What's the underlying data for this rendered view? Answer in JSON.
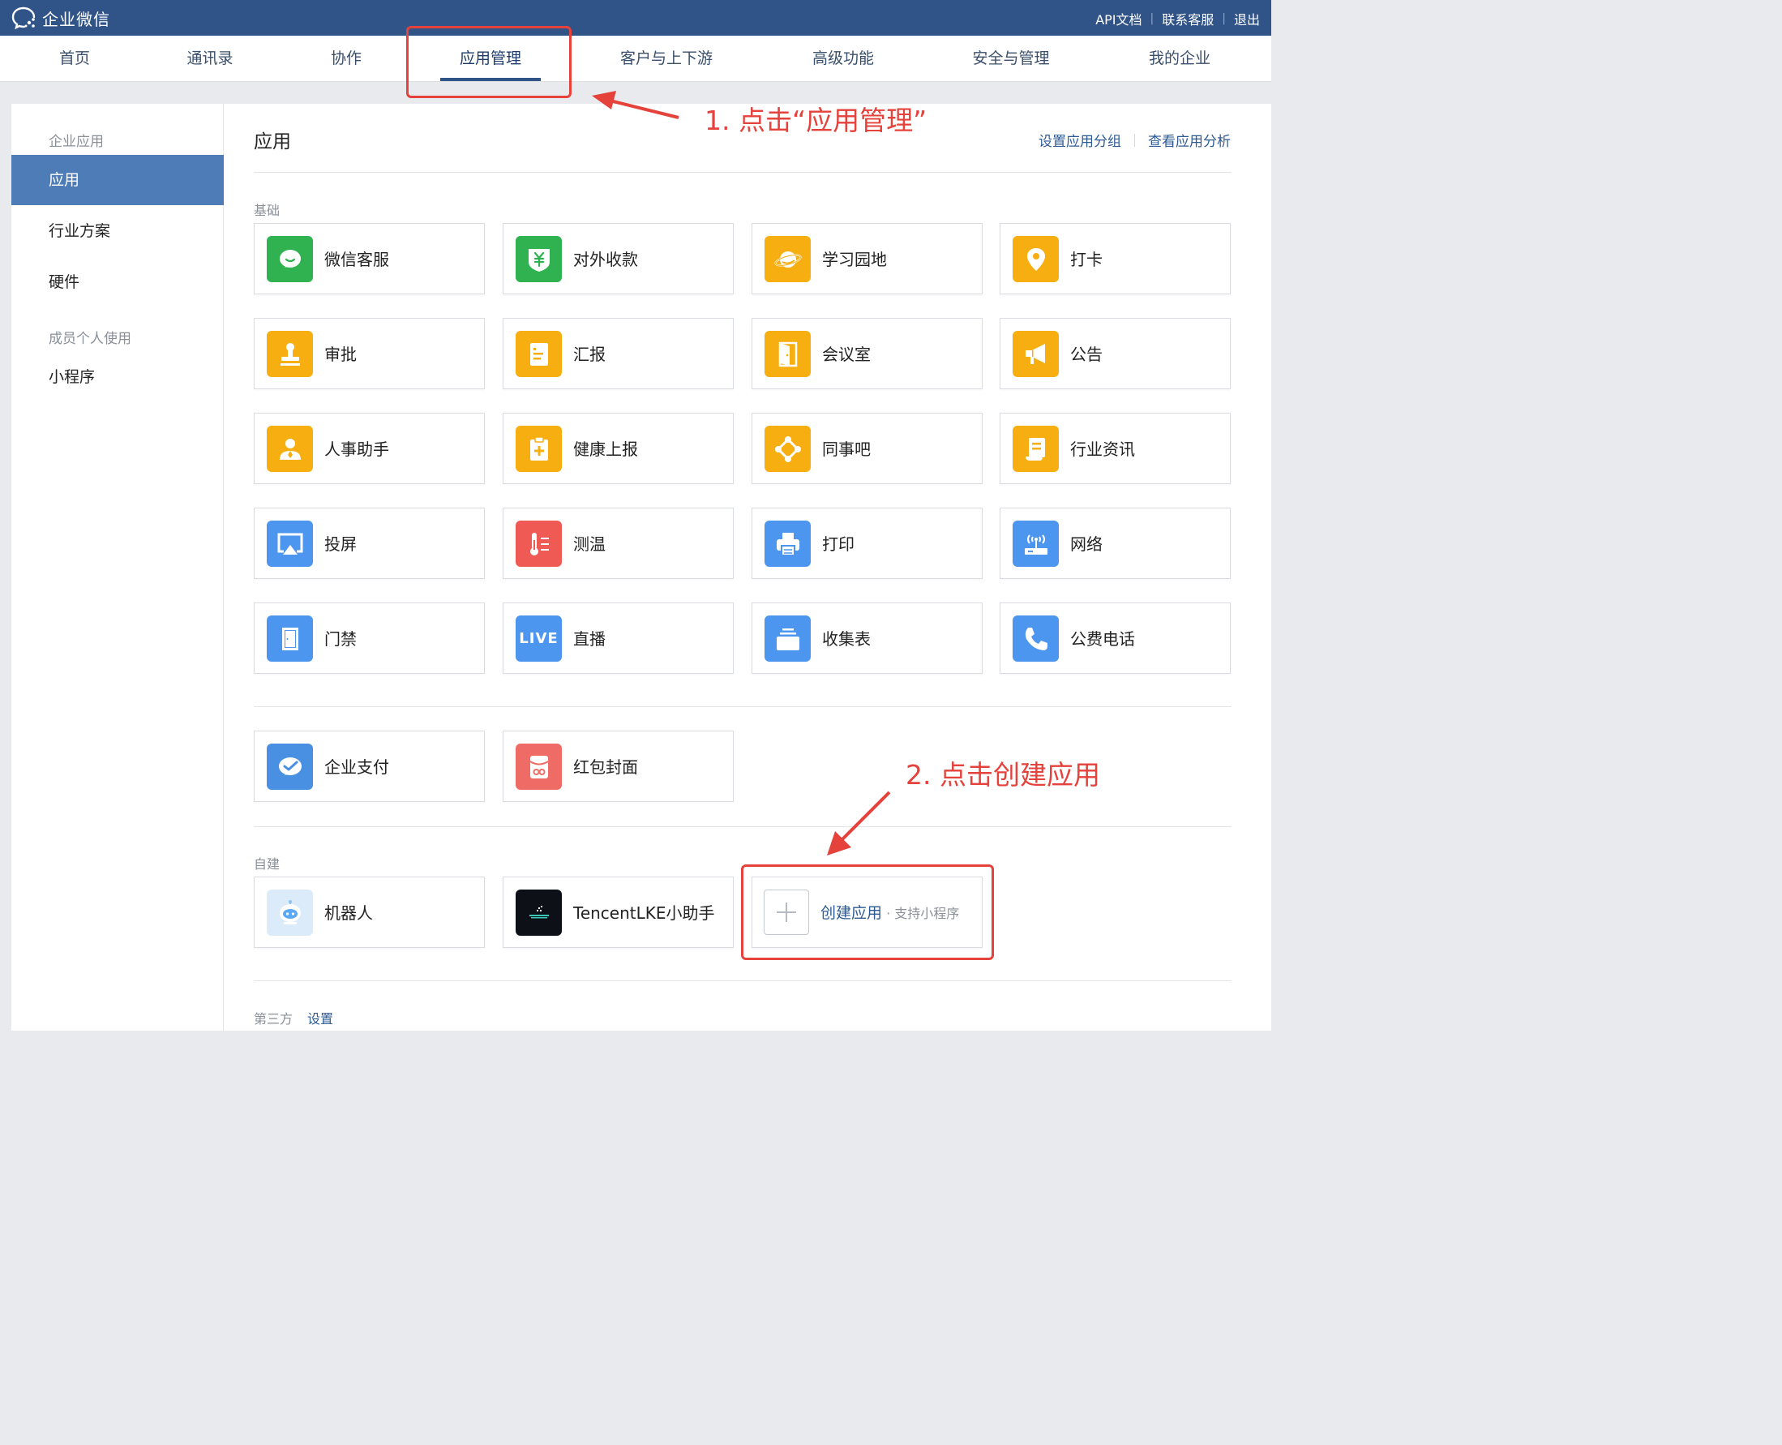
{
  "topbar": {
    "logo_text": "企业微信",
    "links": [
      "API文档",
      "联系客服",
      "退出"
    ]
  },
  "nav": {
    "items": [
      "首页",
      "通讯录",
      "协作",
      "应用管理",
      "客户与上下游",
      "高级功能",
      "安全与管理",
      "我的企业"
    ],
    "active": "应用管理"
  },
  "sidebar": {
    "group1": "企业应用",
    "item_apps": "应用",
    "item_industry": "行业方案",
    "item_hardware": "硬件",
    "group2": "成员个人使用",
    "item_miniprogram": "小程序"
  },
  "main": {
    "title": "应用",
    "link_group": "设置应用分组",
    "link_analysis": "查看应用分析",
    "section_basic": "基础",
    "section_custom": "自建",
    "section_third": "第三方",
    "section_third_link": "设置"
  },
  "basic_apps": [
    {
      "label": "微信客服",
      "icon": "chat-bubble-icon",
      "color": "#2fb24f"
    },
    {
      "label": "对外收款",
      "icon": "yuan-shield-icon",
      "color": "#2fb24f"
    },
    {
      "label": "学习园地",
      "icon": "planet-icon",
      "color": "#f6ae10"
    },
    {
      "label": "打卡",
      "icon": "location-pin-icon",
      "color": "#f6ae10"
    },
    {
      "label": "审批",
      "icon": "stamp-icon",
      "color": "#f6ae10"
    },
    {
      "label": "汇报",
      "icon": "report-doc-icon",
      "color": "#f6ae10"
    },
    {
      "label": "会议室",
      "icon": "door-icon",
      "color": "#f6ae10"
    },
    {
      "label": "公告",
      "icon": "megaphone-icon",
      "color": "#f6ae10"
    },
    {
      "label": "人事助手",
      "icon": "person-icon",
      "color": "#f6ae10"
    },
    {
      "label": "健康上报",
      "icon": "health-clipboard-icon",
      "color": "#f6ae10"
    },
    {
      "label": "同事吧",
      "icon": "network-nodes-icon",
      "color": "#f6ae10"
    },
    {
      "label": "行业资讯",
      "icon": "news-scroll-icon",
      "color": "#f6ae10"
    },
    {
      "label": "投屏",
      "icon": "airplay-icon",
      "color": "#4d96f0"
    },
    {
      "label": "测温",
      "icon": "thermometer-icon",
      "color": "#f05a55"
    },
    {
      "label": "打印",
      "icon": "printer-icon",
      "color": "#4d96f0"
    },
    {
      "label": "网络",
      "icon": "router-icon",
      "color": "#4d96f0"
    },
    {
      "label": "门禁",
      "icon": "door-access-icon",
      "color": "#4d96f0"
    },
    {
      "label": "直播",
      "icon": "live-icon",
      "icon_text": "LIVE",
      "color": "#4d96f0"
    },
    {
      "label": "收集表",
      "icon": "stack-tray-icon",
      "color": "#4d96f0"
    },
    {
      "label": "公费电话",
      "icon": "phone-icon",
      "color": "#4d96f0"
    }
  ],
  "extra_apps": [
    {
      "label": "企业支付",
      "icon": "wechat-pay-icon",
      "color": "#4a90e2"
    },
    {
      "label": "红包封面",
      "icon": "red-envelope-icon",
      "color": "#ee6b66"
    }
  ],
  "custom_apps": [
    {
      "label": "机器人",
      "icon": "robot-icon"
    },
    {
      "label": "TencentLKE小助手",
      "icon": "tencent-lke-icon"
    }
  ],
  "create_app": {
    "label": "创建应用",
    "sub": " · 支持小程序"
  },
  "annotations": {
    "step1": "1. 点击“应用管理”",
    "step2": "2. 点击创建应用",
    "color": "#e5423c"
  }
}
